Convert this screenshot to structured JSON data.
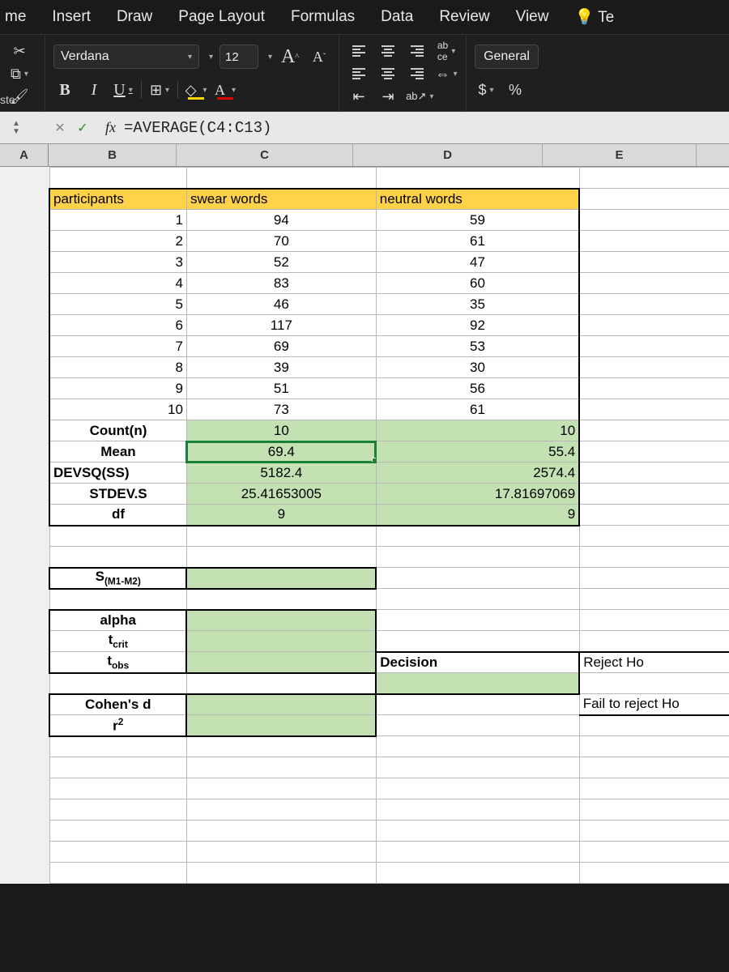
{
  "ribbon": {
    "tabs": [
      "me",
      "Insert",
      "Draw",
      "Page Layout",
      "Formulas",
      "Data",
      "Review",
      "View",
      "Te"
    ]
  },
  "toolbar": {
    "paste_label": "ste",
    "font_name": "Verdana",
    "font_size": "12",
    "bold": "B",
    "italic": "I",
    "underline": "U",
    "grow_font": "A",
    "shrink_font": "A",
    "font_color_label": "A",
    "number_format": "General",
    "currency": "$",
    "percent": "%"
  },
  "namebox": {
    "cell": "",
    "formula": "=AVERAGE(C4:C13)"
  },
  "fx_label": "fx",
  "columns": {
    "A": "A",
    "B": "B",
    "C": "C",
    "D": "D",
    "E": "E"
  },
  "headers": {
    "participants": "participants",
    "swear": "swear words",
    "neutral": "neutral words"
  },
  "data_rows": [
    {
      "p": "1",
      "s": "94",
      "n": "59"
    },
    {
      "p": "2",
      "s": "70",
      "n": "61"
    },
    {
      "p": "3",
      "s": "52",
      "n": "47"
    },
    {
      "p": "4",
      "s": "83",
      "n": "60"
    },
    {
      "p": "5",
      "s": "46",
      "n": "35"
    },
    {
      "p": "6",
      "s": "117",
      "n": "92"
    },
    {
      "p": "7",
      "s": "69",
      "n": "53"
    },
    {
      "p": "8",
      "s": "39",
      "n": "30"
    },
    {
      "p": "9",
      "s": "51",
      "n": "56"
    },
    {
      "p": "10",
      "s": "73",
      "n": "61"
    }
  ],
  "stats": {
    "count_label": "Count(n)",
    "count_s": "10",
    "count_n": "10",
    "mean_label": "Mean",
    "mean_s": "69.4",
    "mean_n": "55.4",
    "devsq_label": "DEVSQ(SS)",
    "devsq_s": "5182.4",
    "devsq_n": "2574.4",
    "stdev_label": "STDEV.S",
    "stdev_s": "25.41653005",
    "stdev_n": "17.81697069",
    "df_label": "df",
    "df_s": "9",
    "df_n": "9"
  },
  "labels": {
    "sm1m2": "S(M1-M2)",
    "alpha": "alpha",
    "tcrit_pre": "t",
    "tcrit_sub": "crit",
    "tobs_pre": "t",
    "tobs_sub": "obs",
    "decision": "Decision",
    "reject": "Reject Ho",
    "cohen": "Cohen's d",
    "r2_pre": "r",
    "r2_sup": "2",
    "fail": "Fail to reject Ho"
  }
}
